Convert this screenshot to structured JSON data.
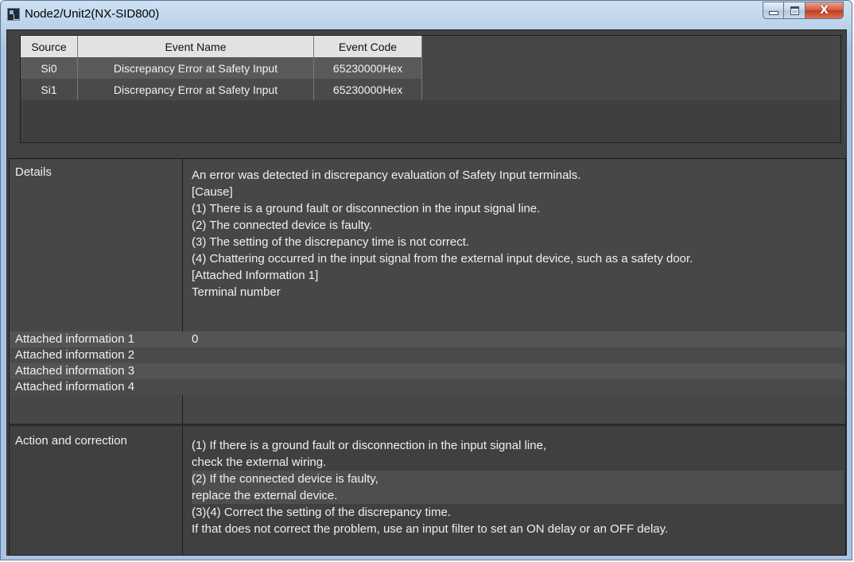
{
  "window": {
    "title": "Node2/Unit2(NX-SID800)",
    "controls": {
      "minimize": "minimize",
      "maximize": "maximize",
      "close": "X"
    }
  },
  "events_table": {
    "headers": [
      "Source",
      "Event Name",
      "Event Code",
      ""
    ],
    "rows": [
      {
        "source": "Si0",
        "event_name": "Discrepancy Error at Safety Input",
        "event_code": "65230000Hex"
      },
      {
        "source": "Si1",
        "event_name": "Discrepancy Error at Safety Input",
        "event_code": "65230000Hex"
      }
    ]
  },
  "details": {
    "label": "Details",
    "lines": [
      "An error was detected in discrepancy evaluation of Safety Input terminals.",
      "[Cause]",
      "(1) There is a ground fault or disconnection in the input signal line.",
      "(2) The connected device is faulty.",
      "(3) The setting of the discrepancy time is not correct.",
      "(4) Chattering occurred in the input signal from the external input device, such as a safety door.",
      "[Attached Information 1]",
      "Terminal number"
    ],
    "attached": [
      {
        "label": "Attached information 1",
        "value": "0"
      },
      {
        "label": "Attached information 2",
        "value": ""
      },
      {
        "label": "Attached information 3",
        "value": ""
      },
      {
        "label": "Attached information 4",
        "value": ""
      }
    ]
  },
  "action": {
    "label": "Action and correction",
    "lines": [
      "(1) If there is a ground fault or disconnection in the input signal line,",
      "check the external wiring.",
      "(2) If the connected device is faulty,",
      "replace the external device.",
      "(3)(4) Correct the setting of the discrepancy time.",
      "If that does not correct the problem, use an input filter to set an ON delay or an OFF delay."
    ]
  }
}
